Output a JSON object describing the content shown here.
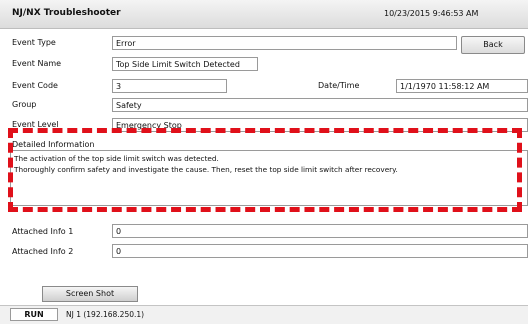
{
  "header": {
    "title": "NJ/NX Troubleshooter",
    "datetime": "10/23/2015 9:46:53 AM"
  },
  "buttons": {
    "back": "Back",
    "screenshot": "Screen Shot"
  },
  "event": {
    "type_label": "Event Type",
    "type_value": "Error",
    "name_label": "Event Name",
    "name_value": "Top Side Limit Switch Detected",
    "code_label": "Event Code",
    "code_value": "3",
    "datetime_label": "Date/Time",
    "datetime_value": "1/1/1970 11:58:12 AM",
    "group_label": "Group",
    "group_value": "Safety",
    "level_label": "Event Level",
    "level_value": "Emergency Stop"
  },
  "details": {
    "label": "Detailed Information",
    "lines": [
      "The activation of the top side limit switch was detected.",
      "Thoroughly confirm safety and investigate the cause. Then, reset the top side limit switch after recovery."
    ]
  },
  "attached": {
    "info1_label": "Attached Info 1",
    "info1_value": "0",
    "info2_label": "Attached Info 2",
    "info2_value": "0"
  },
  "status": {
    "mode": "RUN",
    "controller": "NJ 1 (192.168.250.1)"
  },
  "colors": {
    "highlight": "#e0101a"
  }
}
